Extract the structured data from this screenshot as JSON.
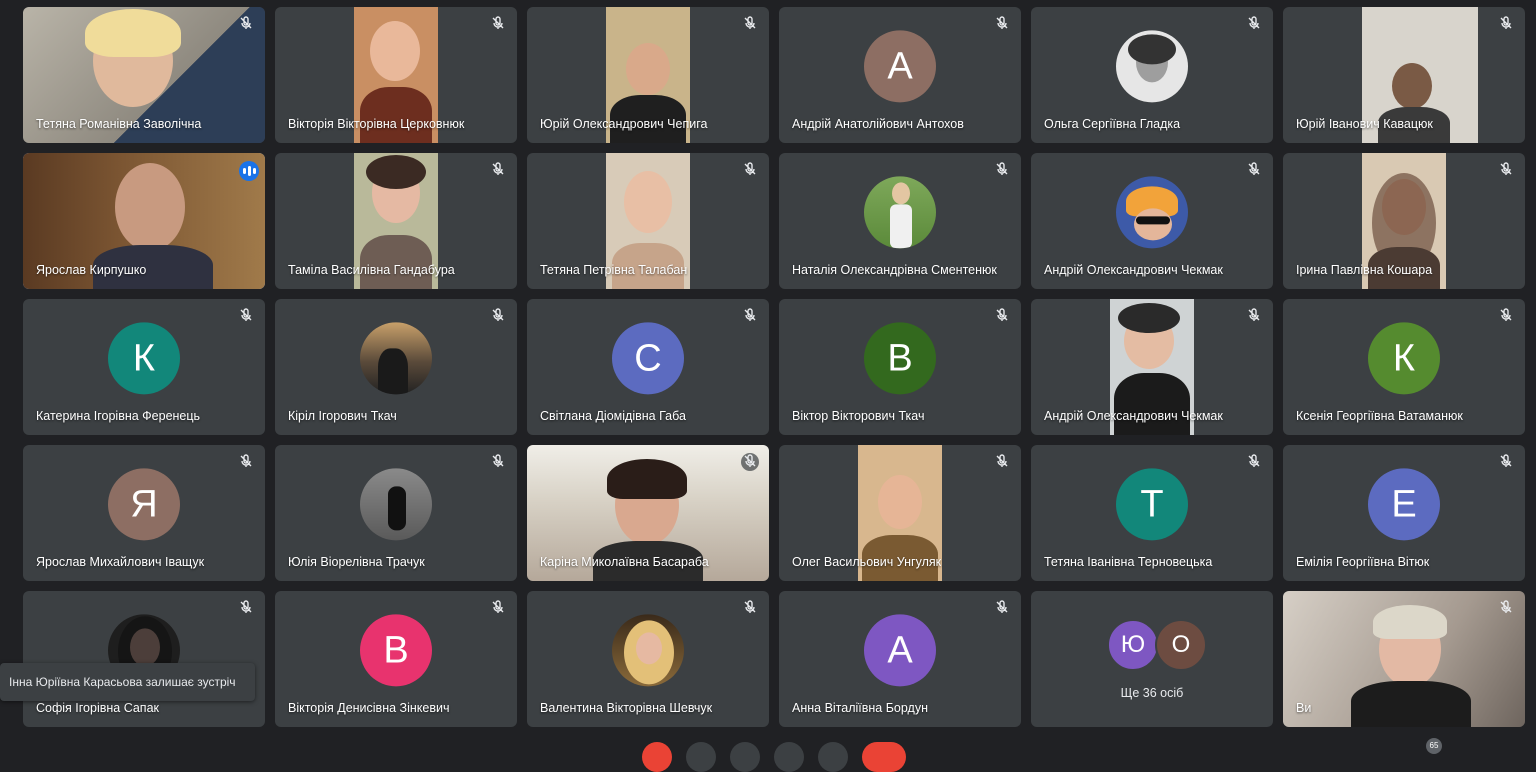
{
  "participants": [
    {
      "name": "Тетяна Романівна Заволічна"
    },
    {
      "name": "Вікторія Вікторівна Церковнюк"
    },
    {
      "name": "Юрій Олександрович Чепига"
    },
    {
      "name": "Андрій Анатолійович Антохов",
      "initial": "А",
      "color": "#8d6e63"
    },
    {
      "name": "Ольга Сергіївна Гладка"
    },
    {
      "name": "Юрій Іванович Кавацюк"
    },
    {
      "name": "Ярослав Кирпушко"
    },
    {
      "name": "Таміла Василівна Гандабура"
    },
    {
      "name": "Тетяна Петрівна Талабан"
    },
    {
      "name": "Наталія Олександрівна Сментенюк"
    },
    {
      "name": "Андрій Олександрович Чекмак"
    },
    {
      "name": "Ірина Павлівна Кошара"
    },
    {
      "name": "Катерина Ігорівна Ференець",
      "initial": "К",
      "color": "#12877a"
    },
    {
      "name": "Кіріл Ігорович Ткач"
    },
    {
      "name": "Світлана Діомідівна Габа",
      "initial": "С",
      "color": "#5c6bc0"
    },
    {
      "name": "Віктор Вікторович Ткач",
      "initial": "В",
      "color": "#33691e"
    },
    {
      "name": "Андрій Олександрович Чекмак"
    },
    {
      "name": "Ксенія Георгіївна Ватаманюк",
      "initial": "К",
      "color": "#558b2f"
    },
    {
      "name": "Ярослав Михайлович Іващук",
      "initial": "Я",
      "color": "#8d6e63"
    },
    {
      "name": "Юлія Віорелівна Трачук"
    },
    {
      "name": "Каріна Миколаївна Басараба"
    },
    {
      "name": "Олег Васильович Унгуляк"
    },
    {
      "name": "Тетяна Іванівна Терновецька",
      "initial": "Т",
      "color": "#12877a"
    },
    {
      "name": "Емілія Георгіївна Вітюк",
      "initial": "Е",
      "color": "#5c6bc0"
    },
    {
      "name": "Софія Ігорівна Сапак"
    },
    {
      "name": "Вікторія Денисівна Зінкевич",
      "initial": "В",
      "color": "#e8336e"
    },
    {
      "name": "Валентина Вікторівна Шевчук"
    },
    {
      "name": "Анна Віталіївна Бордун",
      "initial": "А",
      "color": "#7e57c2"
    },
    {
      "name": "Ви"
    }
  ],
  "more_tile": {
    "label": "Ще 36 осіб",
    "avatars": [
      {
        "initial": "Ю",
        "color": "#7e57c2"
      },
      {
        "initial": "О",
        "color": "#6d4c41"
      }
    ]
  },
  "toast": "Інна Юріївна Карасьова залишає зустріч",
  "participant_count": "65",
  "icons": {
    "muted": "mic-off-icon",
    "speaking": "speaking-indicator-icon"
  },
  "colors": {
    "background": "#202124",
    "tile": "#3c4043",
    "active_outline": "#8ab4f8",
    "end_call": "#ea4335"
  }
}
